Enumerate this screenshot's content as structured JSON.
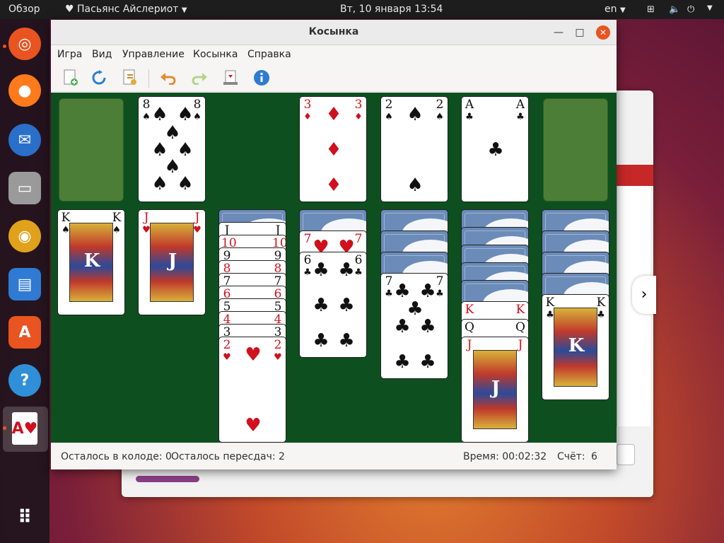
{
  "topbar": {
    "activities": "Обзор",
    "app_menu": "Пасьянс Айслериот",
    "clock": "Вт, 10 января  13:54",
    "lang": "en"
  },
  "window": {
    "title": "Косынка"
  },
  "menu": {
    "game": "Игра",
    "view": "Вид",
    "control": "Управление",
    "klondike": "Косынка",
    "help": "Справка"
  },
  "statusbar": {
    "stock_left": "Осталось в колоде: 0",
    "redeals_left": "Осталось пересдач: 2",
    "time": "Время: 00:02:32",
    "score_label": "Счёт:",
    "score_value": "6"
  },
  "colors": {
    "table": "#0d4f1f",
    "slot": "#4c7e37",
    "accent": "#e95420"
  },
  "cards": {
    "waste_top": {
      "rank": "8",
      "suit": "♠"
    },
    "f1": {
      "rank": "3",
      "suit": "♦"
    },
    "f2": {
      "rank": "2",
      "suit": "♠"
    },
    "f3": {
      "rank": "A",
      "suit": "♣"
    },
    "t1_k": {
      "rank": "K",
      "suit": "♠"
    },
    "t2_j": {
      "rank": "J",
      "suit": "♥"
    },
    "t3": [
      {
        "rank": "J",
        "suit": ""
      },
      {
        "rank": "10",
        "suit": ""
      },
      {
        "rank": "9",
        "suit": ""
      },
      {
        "rank": "8",
        "suit": ""
      },
      {
        "rank": "7",
        "suit": ""
      },
      {
        "rank": "6",
        "suit": ""
      },
      {
        "rank": "5",
        "suit": ""
      },
      {
        "rank": "4",
        "suit": ""
      },
      {
        "rank": "3",
        "suit": ""
      }
    ],
    "t3_top": {
      "rank": "2",
      "suit": "♥"
    },
    "t4_7": {
      "rank": "7",
      "suit": "♥"
    },
    "t4_6": {
      "rank": "6",
      "suit": "♣"
    },
    "t5_7": {
      "rank": "7",
      "suit": "♣"
    },
    "t6_k": {
      "rank": "K",
      "suit": ""
    },
    "t6_q": {
      "rank": "Q",
      "suit": ""
    },
    "t6_j": {
      "rank": "J",
      "suit": ""
    },
    "t7_k": {
      "rank": "K",
      "suit": "♣"
    }
  }
}
